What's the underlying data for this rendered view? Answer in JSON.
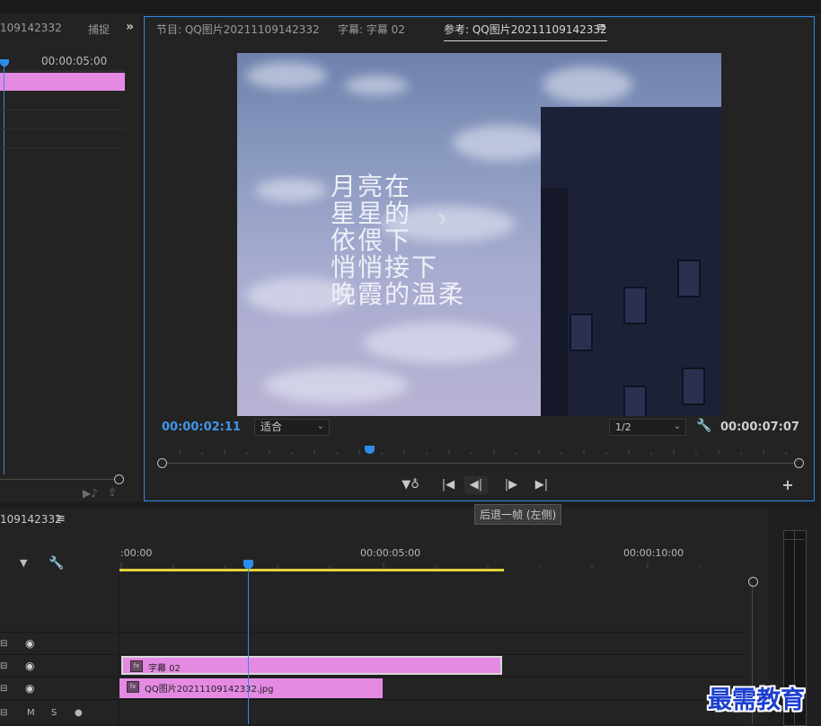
{
  "source_panel": {
    "tab_title": "109142332",
    "tab_capture": "捕捉",
    "more_glyph": "»",
    "timecode": "00:00:05:00"
  },
  "monitor": {
    "tabs": [
      {
        "label": "节目: QQ图片20211109142332"
      },
      {
        "label": "字幕: 字幕 02"
      },
      {
        "label": "参考: QQ图片20211109142332"
      }
    ],
    "menu_glyph": "≡",
    "current_timecode": "00:00:02:11",
    "fit_value": "适合",
    "resolution_value": "1/2",
    "duration_timecode": "00:00:07:07",
    "poem": "月亮在\n星星的\n依偎下\n悄悄接下\n晚霞的温柔",
    "moon_glyph": "☽",
    "controls": {
      "marker": "▼♁",
      "step_in": "|◀",
      "step_back": "◀|",
      "step_fwd": "|▶",
      "step_out": "▶|",
      "add": "+"
    },
    "tooltip": "后退一帧 (左侧)"
  },
  "timeline": {
    "title": "109142332",
    "menu_glyph": "≡",
    "time_labels": [
      ":00:00",
      "00:00:05:00",
      "00:00:10:00"
    ],
    "clips": [
      {
        "label": "字幕 02",
        "badge": "fx"
      },
      {
        "label": "QQ图片20211109142332.jpg",
        "badge": "fx"
      }
    ],
    "bottom_labels": {
      "m": "M",
      "s": "S"
    }
  },
  "watermark": "最需教育",
  "colors": {
    "accent_blue": "#2d8ceb",
    "clip_pink": "#e58ae3",
    "work_area_yellow": "#e3d33c",
    "watermark_blue": "#1c3fd0"
  }
}
